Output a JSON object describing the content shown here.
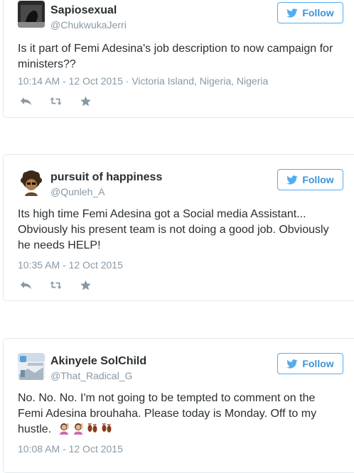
{
  "tweets": [
    {
      "name": "Sapiosexual",
      "handle": "@ChukwukaJerri",
      "follow_label": "Follow",
      "text": "Is it part of Femi Adesina's job description to now campaign for ministers??",
      "timestamp": "10:14 AM - 12 Oct 2015",
      "location": "Victoria Island, Nigeria, Nigeria"
    },
    {
      "name": "pursuit of happiness",
      "handle": "@Qunleh_A",
      "follow_label": "Follow",
      "text": "Its high time Femi Adesina got a Social media Assistant... Obviously his present team is not doing a good job. Obviously he needs HELP!",
      "timestamp": "10:35 AM - 12 Oct 2015"
    },
    {
      "name": "Akinyele SolChild",
      "handle": "@That_Radical_G",
      "follow_label": "Follow",
      "text_line1": "No. No. No. I'm not going to be tempted to comment on the",
      "text_line2": "Femi Adesina brouhaha. Please today is Monday. Off to my",
      "text_line3": "hustle.",
      "emojis": [
        "woman-raising-hand",
        "woman-raising-hand",
        "footprints",
        "footprints"
      ],
      "timestamp": "10:08 AM - 12 Oct 2015"
    }
  ],
  "icons": {
    "twitter_bird": "twitter-bird-icon",
    "reply": "reply-icon",
    "retweet": "retweet-icon",
    "favorite": "star-icon"
  },
  "colors": {
    "follow_blue": "#55acee",
    "meta_gray": "#8899a6",
    "border": "#e1e8ed"
  }
}
